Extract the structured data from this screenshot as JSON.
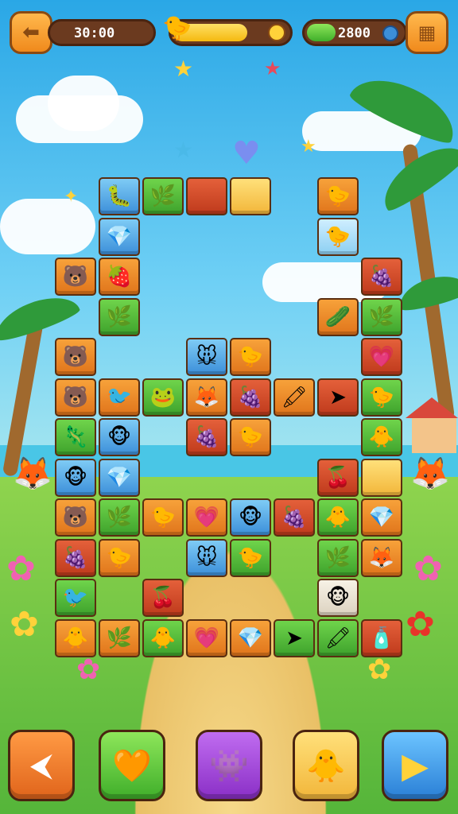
{
  "hud": {
    "timer": "30:00",
    "energy_fraction": 0.62,
    "gems": "2800",
    "gem_icon": "coin-icon",
    "energy_icon": "coin-icon"
  },
  "colors": {
    "orange": "#e0741b",
    "green": "#3ea22c",
    "blue": "#3c8fd9",
    "red": "#bf3a1c",
    "yellow": "#f2b63a"
  },
  "board": {
    "tiles": [
      {
        "col": 0,
        "row": -2,
        "color": "blue",
        "icon": "🐛"
      },
      {
        "col": 1,
        "row": -2,
        "color": "green",
        "icon": "🌿"
      },
      {
        "col": 2,
        "row": -2,
        "color": "red",
        "icon": ""
      },
      {
        "col": 3,
        "row": -2,
        "color": "yellow",
        "icon": ""
      },
      {
        "col": 0,
        "row": -1,
        "color": "blue",
        "icon": "💎"
      },
      {
        "col": 5,
        "row": -2,
        "color": "orange",
        "icon": "🐤"
      },
      {
        "col": 5,
        "row": -1,
        "color": "lightblue",
        "icon": "🐤"
      },
      {
        "col": -1,
        "row": 0,
        "color": "orange",
        "icon": "🐻"
      },
      {
        "col": 0,
        "row": 0,
        "color": "orange",
        "icon": "🍓"
      },
      {
        "col": 6,
        "row": 0,
        "color": "red",
        "icon": "🍇"
      },
      {
        "col": 0,
        "row": 1,
        "color": "green",
        "icon": "🌿"
      },
      {
        "col": 5,
        "row": 1,
        "color": "orange",
        "icon": "🥒"
      },
      {
        "col": 6,
        "row": 1,
        "color": "green",
        "icon": "🌿"
      },
      {
        "col": -1,
        "row": 2,
        "color": "orange",
        "icon": "🐻"
      },
      {
        "col": 2,
        "row": 2,
        "color": "blue",
        "icon": "🐭"
      },
      {
        "col": 3,
        "row": 2,
        "color": "orange",
        "icon": "🐤"
      },
      {
        "col": 6,
        "row": 2,
        "color": "red",
        "icon": "💗"
      },
      {
        "col": -1,
        "row": 3,
        "color": "orange",
        "icon": "🐻"
      },
      {
        "col": 0,
        "row": 3,
        "color": "orange",
        "icon": "🐦"
      },
      {
        "col": 1,
        "row": 3,
        "color": "green",
        "icon": "🐸"
      },
      {
        "col": 2,
        "row": 3,
        "color": "orange",
        "icon": "🦊"
      },
      {
        "col": 3,
        "row": 3,
        "color": "red",
        "icon": "🍇"
      },
      {
        "col": 4,
        "row": 3,
        "color": "orange",
        "icon": "🖍"
      },
      {
        "col": 5,
        "row": 3,
        "color": "red",
        "icon": "➤"
      },
      {
        "col": 6,
        "row": 3,
        "color": "green",
        "icon": "🐤"
      },
      {
        "col": -1,
        "row": 4,
        "color": "green",
        "icon": "🦎"
      },
      {
        "col": 0,
        "row": 4,
        "color": "blue",
        "icon": "🐵"
      },
      {
        "col": 2,
        "row": 4,
        "color": "red",
        "icon": "🍇"
      },
      {
        "col": 3,
        "row": 4,
        "color": "orange",
        "icon": "🐤"
      },
      {
        "col": 6,
        "row": 4,
        "color": "green",
        "icon": "🐥"
      },
      {
        "col": -1,
        "row": 5,
        "color": "blue",
        "icon": "🐵"
      },
      {
        "col": 0,
        "row": 5,
        "color": "blue",
        "icon": "💎"
      },
      {
        "col": 5,
        "row": 5,
        "color": "red",
        "icon": "🍒"
      },
      {
        "col": 6,
        "row": 5,
        "color": "yellow",
        "icon": ""
      },
      {
        "col": -1,
        "row": 6,
        "color": "orange",
        "icon": "🐻"
      },
      {
        "col": 0,
        "row": 6,
        "color": "green",
        "icon": "🌿"
      },
      {
        "col": 1,
        "row": 6,
        "color": "orange",
        "icon": "🐤"
      },
      {
        "col": 2,
        "row": 6,
        "color": "orange",
        "icon": "💗"
      },
      {
        "col": 3,
        "row": 6,
        "color": "blue",
        "icon": "🐵"
      },
      {
        "col": 4,
        "row": 6,
        "color": "red",
        "icon": "🍇"
      },
      {
        "col": 5,
        "row": 6,
        "color": "green",
        "icon": "🐥"
      },
      {
        "col": 6,
        "row": 6,
        "color": "orange",
        "icon": "💎"
      },
      {
        "col": -1,
        "row": 7,
        "color": "red",
        "icon": "🍇"
      },
      {
        "col": 0,
        "row": 7,
        "color": "orange",
        "icon": "🐤"
      },
      {
        "col": 2,
        "row": 7,
        "color": "blue",
        "icon": "🐭"
      },
      {
        "col": 3,
        "row": 7,
        "color": "green",
        "icon": "🐤"
      },
      {
        "col": 5,
        "row": 7,
        "color": "green",
        "icon": "🌿"
      },
      {
        "col": 6,
        "row": 7,
        "color": "orange",
        "icon": "🦊"
      },
      {
        "col": -1,
        "row": 8,
        "color": "green",
        "icon": "🐦"
      },
      {
        "col": 1,
        "row": 8,
        "color": "red",
        "icon": "🍒"
      },
      {
        "col": 5,
        "row": 8,
        "color": "white",
        "icon": "🐵"
      },
      {
        "col": -1,
        "row": 9,
        "color": "orange",
        "icon": "🐥"
      },
      {
        "col": 0,
        "row": 9,
        "color": "orange",
        "icon": "🌿"
      },
      {
        "col": 1,
        "row": 9,
        "color": "green",
        "icon": "🐥"
      },
      {
        "col": 2,
        "row": 9,
        "color": "orange",
        "icon": "💗"
      },
      {
        "col": 3,
        "row": 9,
        "color": "orange",
        "icon": "💎"
      },
      {
        "col": 4,
        "row": 9,
        "color": "green",
        "icon": "➤"
      },
      {
        "col": 5,
        "row": 9,
        "color": "green",
        "icon": "🖍"
      },
      {
        "col": 6,
        "row": 9,
        "color": "red",
        "icon": "🧴"
      }
    ]
  },
  "bottom_bar": {
    "buttons": [
      {
        "name": "back-button",
        "icon": "back-icon",
        "color": "#f07a2a"
      },
      {
        "name": "hint-button",
        "icon": "heart-leaf-icon",
        "color": "#6fd44b"
      },
      {
        "name": "shuffle-button",
        "icon": "monster-icon",
        "color": "#a049d6"
      },
      {
        "name": "monster-button",
        "icon": "yellow-monster-icon",
        "color": "#ffcf3a"
      },
      {
        "name": "play-button",
        "icon": "play-icon",
        "color": "#3c9ce6"
      }
    ]
  }
}
